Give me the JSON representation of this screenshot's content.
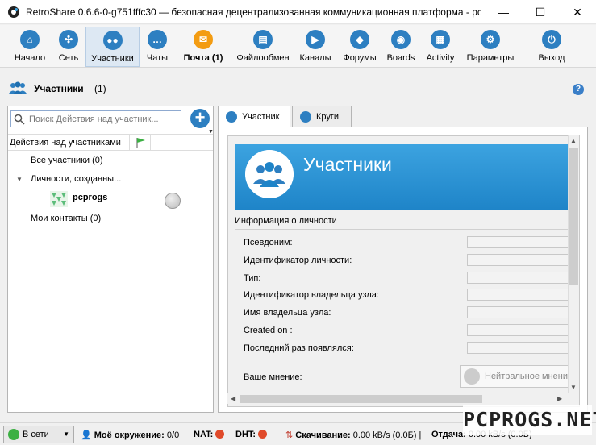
{
  "window": {
    "title": "RetroShare 0.6.6-0-g751fffc30 — безопасная децентрализованная коммуникационная платформа - pc...",
    "minimize": "—",
    "maximize": "☐",
    "close": "✕"
  },
  "toolbar": {
    "items": [
      {
        "label": "Начало",
        "icon": "home-icon",
        "color": "#2d7fc1"
      },
      {
        "label": "Сеть",
        "icon": "network-icon",
        "color": "#2d7fc1"
      },
      {
        "label": "Участники",
        "icon": "people-icon",
        "color": "#2d7fc1"
      },
      {
        "label": "Чаты",
        "icon": "chat-icon",
        "color": "#2d7fc1"
      },
      {
        "label": "Почта (1)",
        "icon": "mail-icon",
        "color": "#f39c12"
      },
      {
        "label": "Файлообмен",
        "icon": "fileshare-icon",
        "color": "#2d7fc1"
      },
      {
        "label": "Каналы",
        "icon": "channels-icon",
        "color": "#2d7fc1"
      },
      {
        "label": "Форумы",
        "icon": "forums-icon",
        "color": "#2d7fc1"
      },
      {
        "label": "Boards",
        "icon": "boards-icon",
        "color": "#2d7fc1"
      },
      {
        "label": "Activity",
        "icon": "activity-icon",
        "color": "#2d7fc1"
      },
      {
        "label": "Параметры",
        "icon": "settings-icon",
        "color": "#2d7fc1"
      },
      {
        "label": "Выход",
        "icon": "power-icon",
        "color": "#2d7fc1"
      }
    ],
    "active_index": 2
  },
  "header": {
    "title": "Участники",
    "count": "(1)",
    "help": "?"
  },
  "left": {
    "search_placeholder": "Поиск Действия над участник...",
    "add_button": "+",
    "column_header": "Действия над участниками",
    "tree": {
      "all": "Все участники (0)",
      "identities": "Личности, созданны...",
      "identity_name": "pcprogs",
      "contacts": "Мои контакты (0)"
    }
  },
  "tabs": [
    {
      "label": "Участник",
      "active": true
    },
    {
      "label": "Круги",
      "active": false
    }
  ],
  "detail": {
    "banner_title": "Участники",
    "section_label": "Информация о личности",
    "fields": [
      {
        "label": "Псевдоним:",
        "value": ""
      },
      {
        "label": "Идентификатор личности:",
        "value": ""
      },
      {
        "label": "Тип:",
        "value": ""
      },
      {
        "label": "Идентификатор владельца узла:",
        "value": ""
      },
      {
        "label": "Имя владельца узла:",
        "value": ""
      },
      {
        "label": "Created on :",
        "value": ""
      },
      {
        "label": "Последний раз появлялся:",
        "value": ""
      }
    ],
    "opinion_label": "Ваше мнение:",
    "opinion_value": "Нейтральное мнение"
  },
  "statusbar": {
    "online": "В сети",
    "neighborhood_label": "Моё окружение:",
    "neighborhood_value": "0/0",
    "nat_label": "NAT:",
    "dht_label": "DHT:",
    "download_label": "Скачивание:",
    "download_value": "0.00 kB/s (0.0Б)",
    "upload_label": "Отдача:",
    "upload_value": "0.00 kB/s (0.0Б)",
    "separator": "|"
  },
  "watermark": "PCPROGS.NET",
  "colors": {
    "accent": "#2d7fc1",
    "banner": "#1e84c8",
    "online": "#3cb043",
    "led_off": "#e04a2a"
  }
}
